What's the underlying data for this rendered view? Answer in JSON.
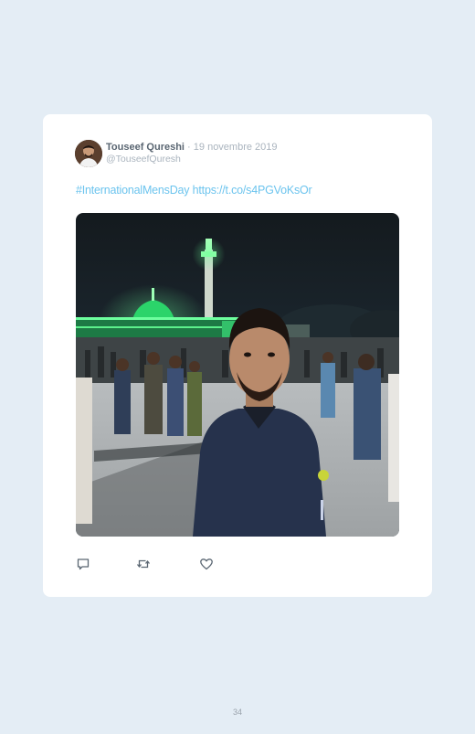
{
  "tweet": {
    "author_name": "Touseef Qureshi",
    "separator": "·",
    "date": "19 novembre 2019",
    "handle": "@TouseefQuresh",
    "hashtag": "#InternationalMensDay",
    "link": "https://t.co/s4PGVoKsOr",
    "media_alt": "photo",
    "actions": {
      "reply_icon": "reply-icon",
      "retweet_icon": "retweet-icon",
      "like_icon": "heart-icon"
    }
  },
  "page": {
    "number": "34"
  },
  "colors": {
    "page_background": "#e4edf5",
    "card_background": "#ffffff",
    "link": "#6cc4ee",
    "muted": "#aab4be",
    "name": "#5a6672"
  }
}
